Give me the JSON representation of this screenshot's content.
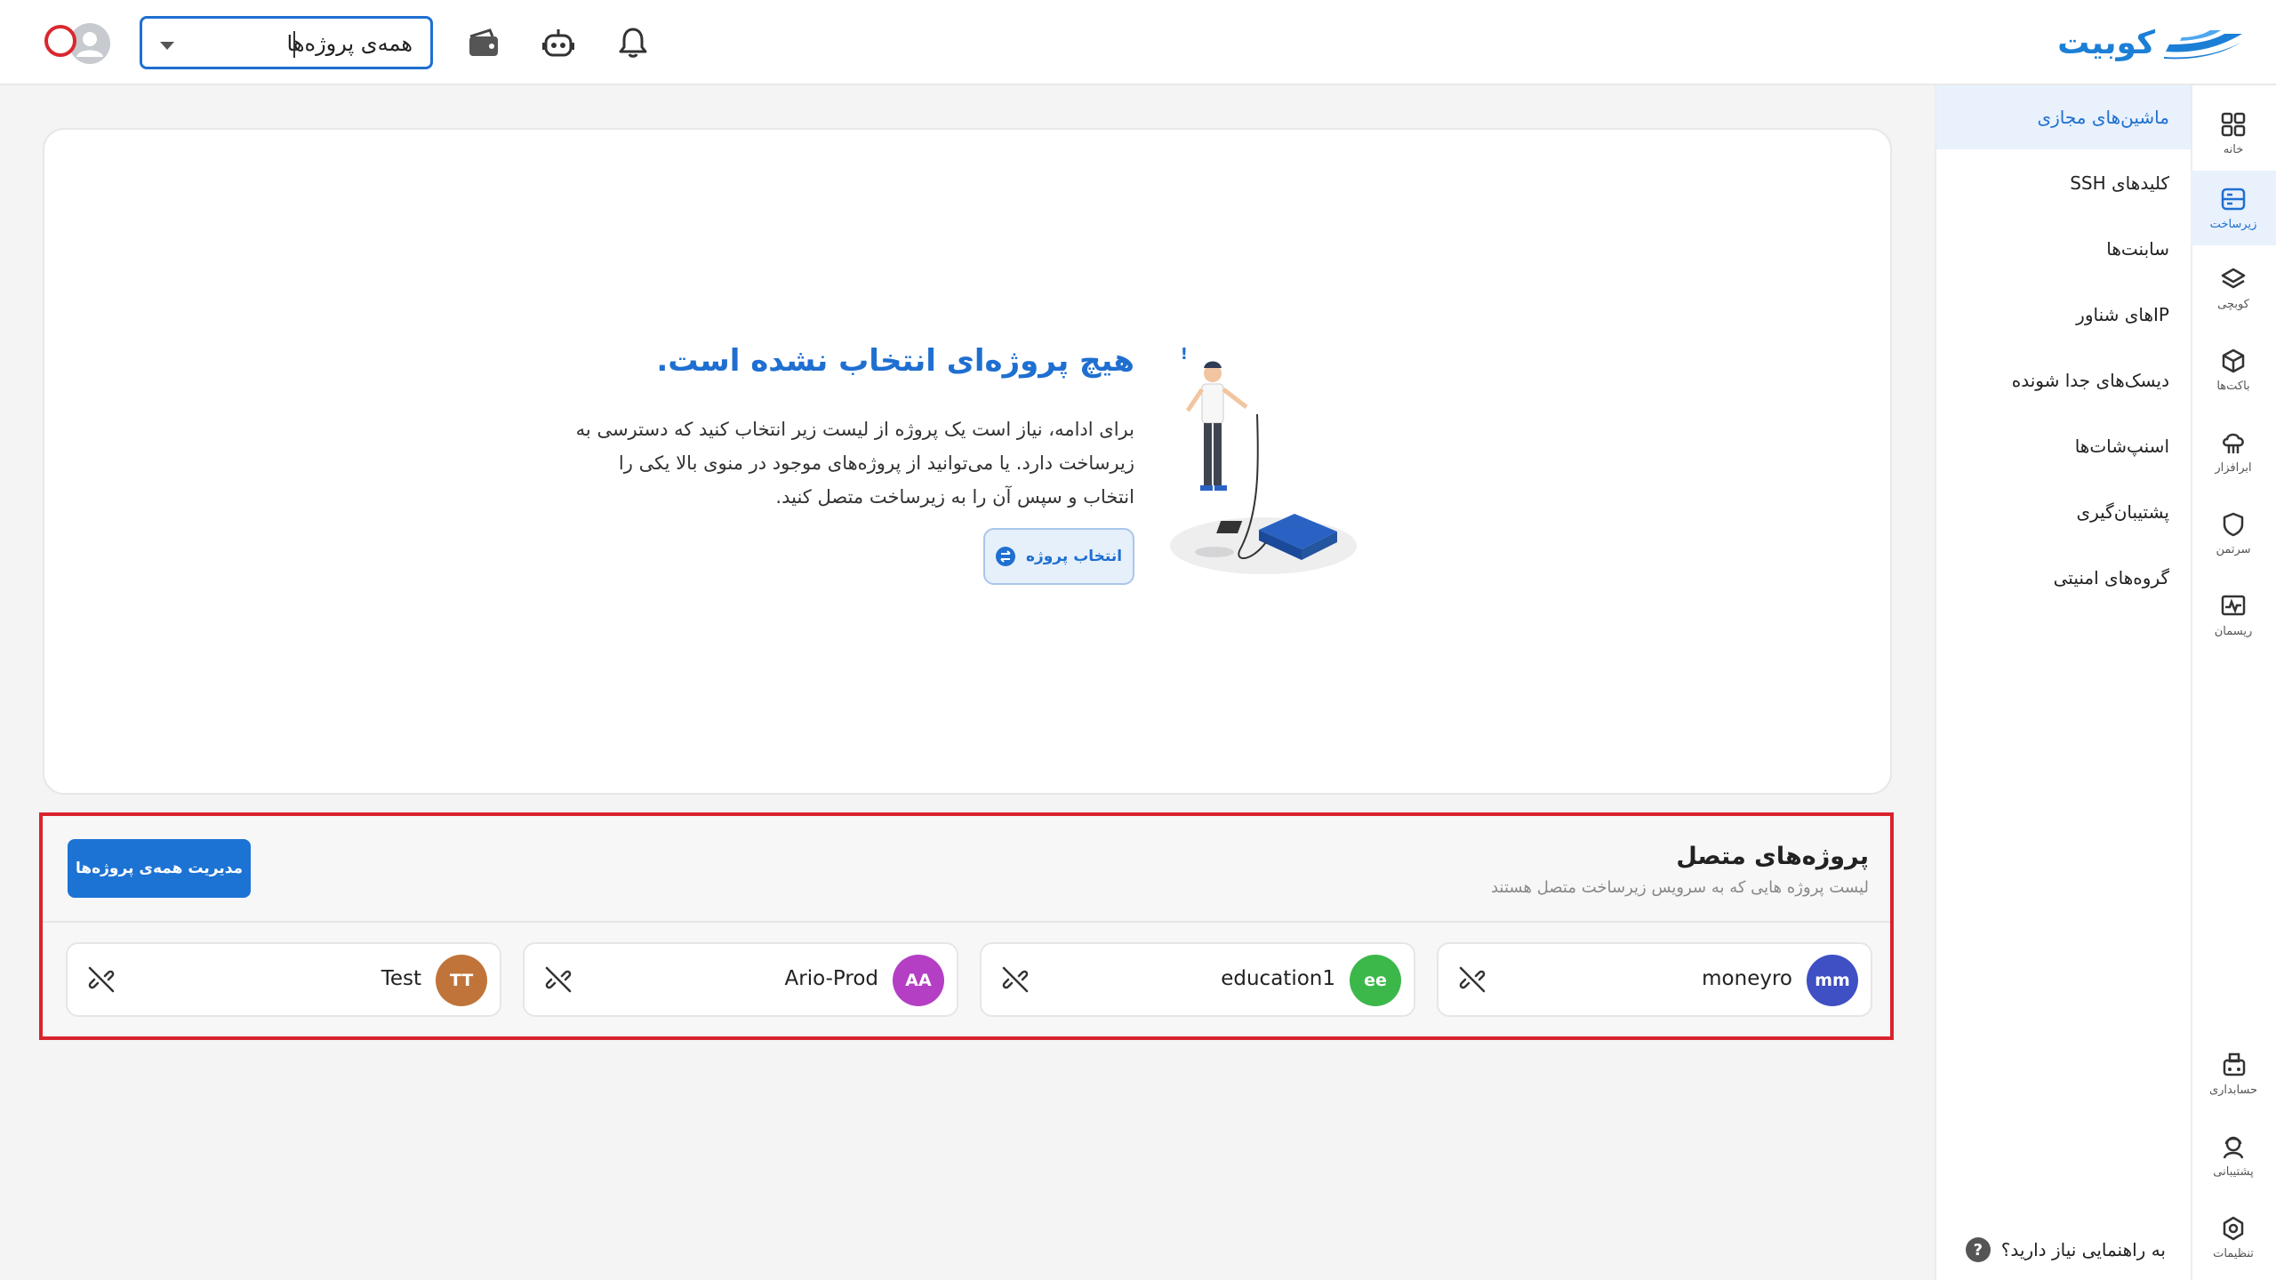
{
  "app": {
    "logo_text": "کوبیت"
  },
  "topbar": {
    "project_select": {
      "value": "همه‌ی پروژه‌ها"
    },
    "icons": [
      "bell-icon",
      "robot-icon",
      "wallet-icon"
    ]
  },
  "rail": {
    "items": [
      {
        "label": "خانه",
        "icon": "grid-icon"
      },
      {
        "label": "زیرساخت",
        "icon": "server-icon",
        "active": true
      },
      {
        "label": "کوبچی",
        "icon": "layers-icon"
      },
      {
        "label": "باکت‌ها",
        "icon": "box-icon"
      },
      {
        "label": "ابرافزار",
        "icon": "cloud-icon"
      },
      {
        "label": "سرتمن",
        "icon": "shield-icon"
      },
      {
        "label": "ریسمان",
        "icon": "pulse-icon"
      }
    ],
    "bottom_items": [
      {
        "label": "حسابداری",
        "icon": "accounting-icon"
      },
      {
        "label": "پشتیبانی",
        "icon": "support-icon"
      },
      {
        "label": "تنظیمات",
        "icon": "settings-icon"
      }
    ]
  },
  "subnav": {
    "items": [
      {
        "label": "ماشین‌های مجازی",
        "active": true
      },
      {
        "label": "کلیدهای SSH"
      },
      {
        "label": "سابنت‌ها"
      },
      {
        "label": "IPهای شناور"
      },
      {
        "label": "دیسک‌های جدا شونده"
      },
      {
        "label": "اسنپ‌شات‌ها"
      },
      {
        "label": "پشتیبان‌گیری"
      },
      {
        "label": "گروه‌های امنیتی"
      }
    ],
    "help_text": "به راهنمایی نیاز دارید؟",
    "help_glyph": "?"
  },
  "empty_state": {
    "title": "هیچ پروژه‌ای انتخاب نشده است.",
    "description": "برای ادامه، نیاز است یک پروژه از لیست زیر انتخاب کنید که دسترسی به زیرساخت دارد. یا می‌توانید از پروژه‌های موجود در منوی بالا یکی را انتخاب و سپس آن را به زیرساخت متصل کنید.",
    "button_label": "انتخاب پروژه"
  },
  "connected_projects": {
    "title": "پروژه‌های متصل",
    "subtitle": "لیست پروژه هایی که به سرویس زیرساخت متصل هستند",
    "manage_button": "مدیریت همه‌ی پروژه‌ها",
    "projects": [
      {
        "initials": "mm",
        "name": "moneyro",
        "color": "#3f4fc4"
      },
      {
        "initials": "ee",
        "name": "education1",
        "color": "#3cb84a"
      },
      {
        "initials": "AA",
        "name": "Ario-Prod",
        "color": "#b43fc4"
      },
      {
        "initials": "TT",
        "name": "Test",
        "color": "#c0743a"
      }
    ]
  },
  "colors": {
    "primary": "#1f6fd1",
    "highlight_border": "#d9232c"
  }
}
